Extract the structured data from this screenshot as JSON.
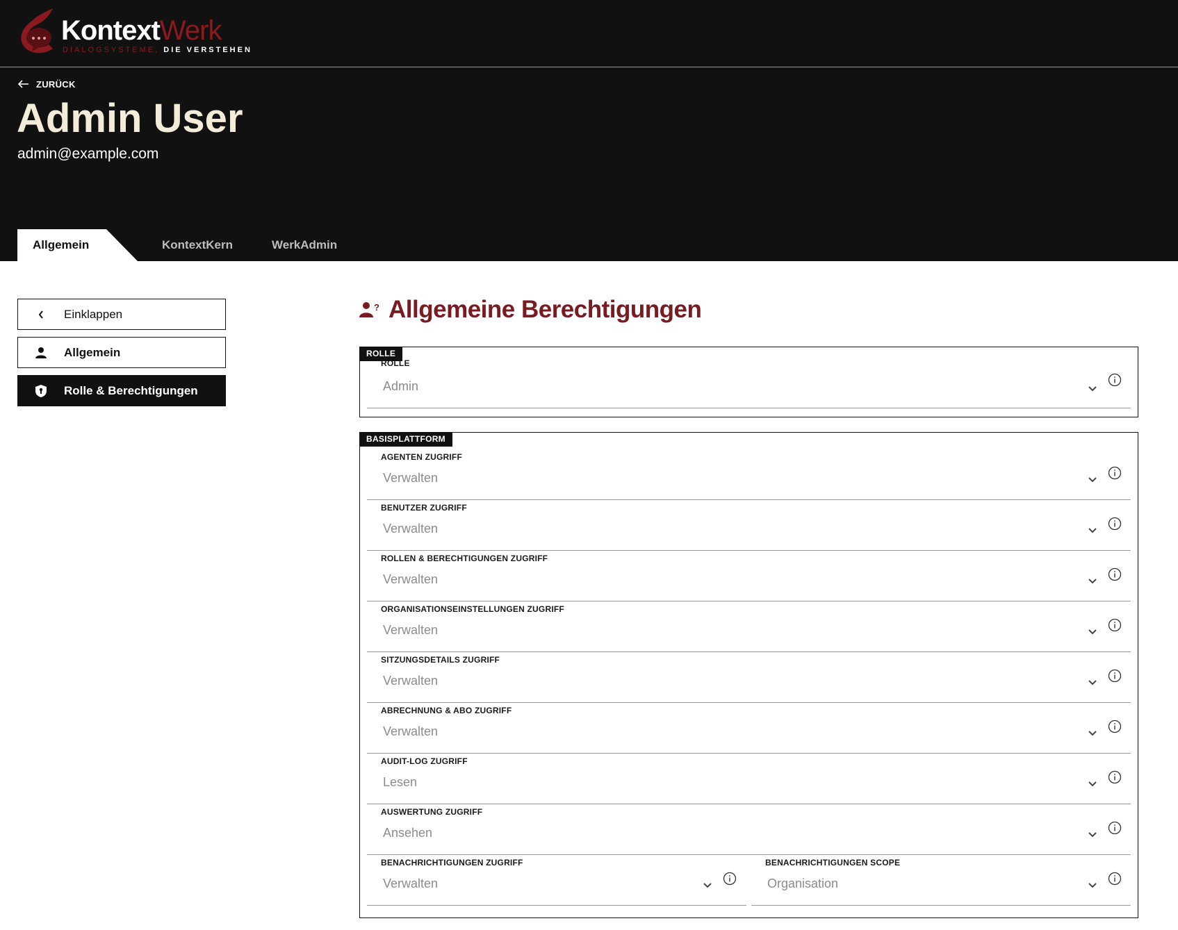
{
  "brand": {
    "word_part1": "Kontext",
    "word_part2": "Werk",
    "tagline_part1": "DIALOGSYSTEME,",
    "tagline_part2": "DIE VERSTEHEN",
    "accent_color": "#8b1a1f"
  },
  "header": {
    "back_label": "ZURÜCK",
    "user_name": "Admin User",
    "user_email": "admin@example.com"
  },
  "tabs": [
    {
      "label": "Allgemein",
      "active": true
    },
    {
      "label": "KontextKern",
      "active": false
    },
    {
      "label": "WerkAdmin",
      "active": false
    }
  ],
  "sidebar": {
    "collapse_label": "Einklappen",
    "items": [
      {
        "label": "Allgemein",
        "icon": "person-icon",
        "active": false
      },
      {
        "label": "Rolle & Berechtigungen",
        "icon": "shield-icon",
        "active": true
      }
    ]
  },
  "main": {
    "title": "Allgemeine Berechtigungen",
    "title_icon": "person-question-icon",
    "title_color": "#7a1b21",
    "role_group": {
      "tag": "ROLLE",
      "field_label": "ROLLE",
      "field_value": "Admin"
    },
    "platform_group": {
      "tag": "BASISPLATTFORM",
      "fields": [
        {
          "label": "AGENTEN ZUGRIFF",
          "value": "Verwalten"
        },
        {
          "label": "BENUTZER ZUGRIFF",
          "value": "Verwalten"
        },
        {
          "label": "ROLLEN & BERECHTIGUNGEN ZUGRIFF",
          "value": "Verwalten"
        },
        {
          "label": "ORGANISATIONSEINSTELLUNGEN ZUGRIFF",
          "value": "Verwalten"
        },
        {
          "label": "SITZUNGSDETAILS ZUGRIFF",
          "value": "Verwalten"
        },
        {
          "label": "ABRECHNUNG & ABO ZUGRIFF",
          "value": "Verwalten"
        },
        {
          "label": "AUDIT-LOG ZUGRIFF",
          "value": "Lesen"
        },
        {
          "label": "AUSWERTUNG ZUGRIFF",
          "value": "Ansehen"
        }
      ],
      "split_fields": [
        {
          "label": "BENACHRICHTIGUNGEN ZUGRIFF",
          "value": "Verwalten"
        },
        {
          "label": "BENACHRICHTIGUNGEN SCOPE",
          "value": "Organisation"
        }
      ]
    }
  }
}
